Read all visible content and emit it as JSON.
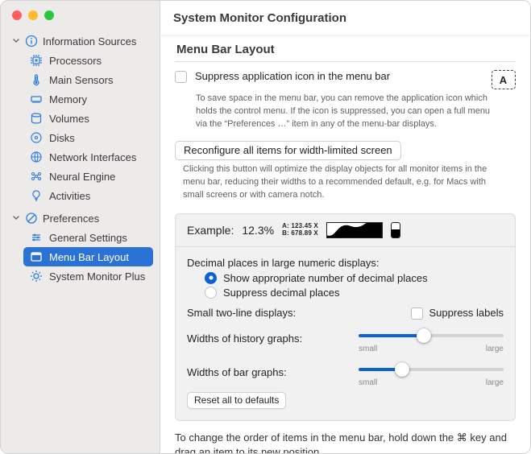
{
  "title": "System Monitor Configuration",
  "sidebar": {
    "groups": [
      {
        "label": "Information Sources",
        "items": [
          {
            "label": "Processors"
          },
          {
            "label": "Main Sensors"
          },
          {
            "label": "Memory"
          },
          {
            "label": "Volumes"
          },
          {
            "label": "Disks"
          },
          {
            "label": "Network Interfaces"
          },
          {
            "label": "Neural Engine"
          },
          {
            "label": "Activities"
          }
        ]
      },
      {
        "label": "Preferences",
        "items": [
          {
            "label": "General Settings"
          },
          {
            "label": "Menu Bar Layout",
            "selected": true
          },
          {
            "label": "System Monitor Plus"
          }
        ]
      }
    ]
  },
  "section_title": "Menu Bar Layout",
  "suppress_icon": {
    "label": "Suppress application icon in the menu bar",
    "checked": false,
    "help": "To save space in the menu bar, you can remove the application icon which holds the control menu. If the icon is suppressed, you can open a full menu via the “Preferences …” item in any of the menu-bar displays."
  },
  "font_box": "A",
  "reconfigure_btn": "Reconfigure all items for width-limited screen",
  "reconfigure_help": "Clicking this button will optimize the display objects for all monitor items in the menu bar, reducing their widths to a recommended default, e.g. for Macs with small screens or with camera notch.",
  "example": {
    "label": "Example:",
    "percent": "12.3%",
    "line1": "A: 123.45 X",
    "line2": "B: 678.89 X"
  },
  "decimal": {
    "label": "Decimal places in large numeric displays:",
    "options": [
      "Show appropriate number of decimal places",
      "Suppress decimal places"
    ],
    "selected": 0
  },
  "twoline": {
    "label": "Small two-line displays:",
    "checkbox_label": "Suppress labels",
    "checked": false
  },
  "sliders": {
    "history": {
      "label": "Widths of history graphs:",
      "value": 0.45
    },
    "bar": {
      "label": "Widths of bar graphs:",
      "value": 0.3
    },
    "min_label": "small",
    "max_label": "large"
  },
  "reset_btn": "Reset all to defaults",
  "footer": {
    "prefix": "To change the order of items in the menu bar, hold down the ",
    "key": "⌘",
    "suffix": " key and drag an item to its new position."
  }
}
